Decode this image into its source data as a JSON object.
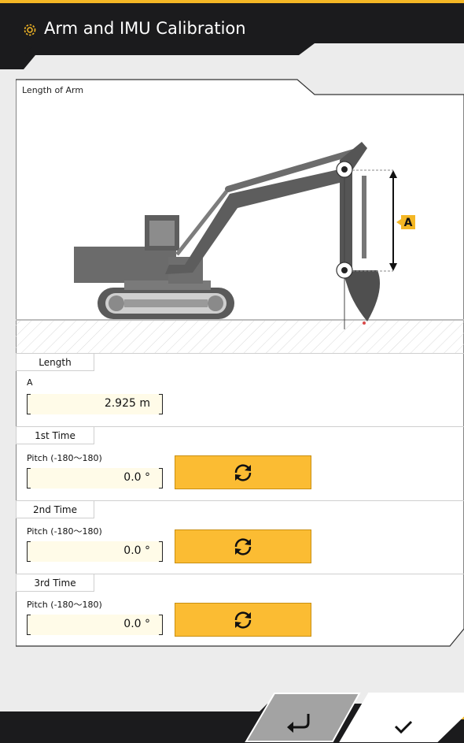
{
  "header": {
    "title": "Arm and IMU Calibration",
    "icon": "gear-icon",
    "accent": "#f4b725"
  },
  "panel": {
    "title": "Length of Arm",
    "diagram": {
      "marker_label": "A"
    }
  },
  "length_section": {
    "tab": "Length",
    "field_label": "A",
    "value": "2.925 m"
  },
  "measurements": [
    {
      "tab": "1st Time",
      "field_label": "Pitch (-180〜180)",
      "value": "0.0 °",
      "button_icon": "refresh-icon"
    },
    {
      "tab": "2nd Time",
      "field_label": "Pitch (-180〜180)",
      "value": "0.0 °",
      "button_icon": "refresh-icon"
    },
    {
      "tab": "3rd Time",
      "field_label": "Pitch (-180〜180)",
      "value": "0.0 °",
      "button_icon": "refresh-icon"
    }
  ],
  "footer": {
    "back_icon": "return-arrow-icon",
    "confirm_icon": "checkmark-icon"
  }
}
